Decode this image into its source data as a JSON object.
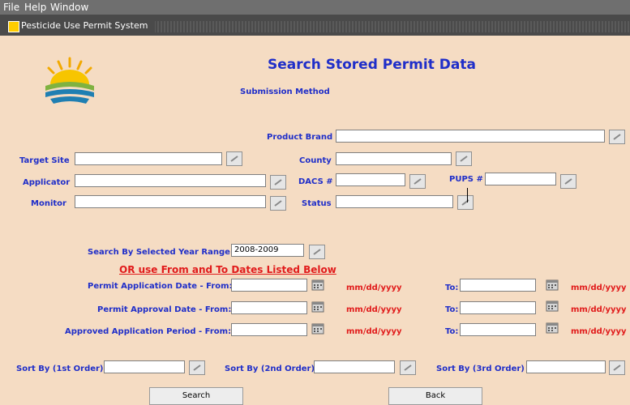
{
  "menu": {
    "file": "File",
    "help": "Help",
    "window": "Window"
  },
  "window": {
    "title": "Pesticide Use Permit System"
  },
  "form": {
    "title": "Search Stored Permit Data",
    "submission_method_label": "Submission Method",
    "product_brand_label": "Product Brand",
    "target_site_label": "Target Site",
    "county_label": "County",
    "applicator_label": "Applicator",
    "dacs_label": "DACS #",
    "pups_label": "PUPS #",
    "monitor_label": "Monitor",
    "status_label": "Status",
    "year_range_label": "Search By Selected Year Range",
    "year_range_value": "2008-2009",
    "or_use_label": "OR use From and To Dates Listed Below",
    "permit_app_from_label": "Permit Application Date - From:",
    "permit_approval_from_label": "Permit Approval Date - From:",
    "approved_period_from_label": "Approved Application Period - From:",
    "to_label": "To:",
    "date_format": "mm/dd/yyyy",
    "sort1_label": "Sort By (1st Order)",
    "sort2_label": "Sort By (2nd Order)",
    "sort3_label": "Sort By (3rd Order)",
    "search_button": "Search",
    "back_button": "Back"
  },
  "colors": {
    "background": "#f5dcc3",
    "label_blue": "#1f2ec9",
    "label_red": "#e11b1b"
  }
}
